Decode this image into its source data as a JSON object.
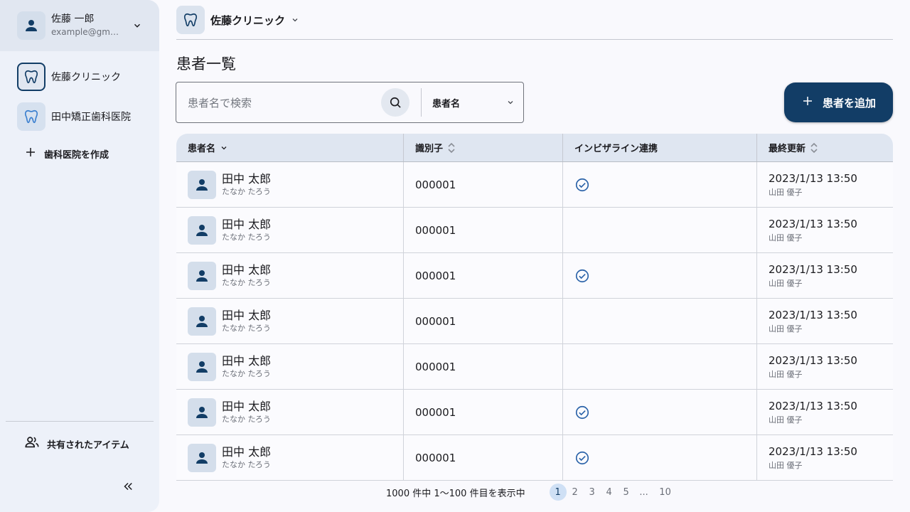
{
  "account": {
    "name": "佐藤 一郎",
    "email": "example@gma..."
  },
  "sidebar": {
    "clinics": [
      {
        "label": "佐藤クリニック",
        "active": true
      },
      {
        "label": "田中矯正歯科医院",
        "active": false
      }
    ],
    "create_label": "歯科医院を作成",
    "shared_label": "共有されたアイテム"
  },
  "header": {
    "clinic_name": "佐藤クリニック"
  },
  "page": {
    "title": "患者一覧"
  },
  "search": {
    "placeholder": "患者名で検索",
    "field_label": "患者名"
  },
  "add_button_label": "患者を追加",
  "table": {
    "columns": [
      "患者名",
      "識別子",
      "インビザライン連携",
      "最終更新"
    ],
    "rows": [
      {
        "name": "田中 太郎",
        "kana": "たなか たろう",
        "id": "000001",
        "linked": true,
        "updated": "2023/1/13 13:50",
        "updated_by": "山田 優子"
      },
      {
        "name": "田中 太郎",
        "kana": "たなか たろう",
        "id": "000001",
        "linked": false,
        "updated": "2023/1/13 13:50",
        "updated_by": "山田 優子"
      },
      {
        "name": "田中 太郎",
        "kana": "たなか たろう",
        "id": "000001",
        "linked": true,
        "updated": "2023/1/13 13:50",
        "updated_by": "山田 優子"
      },
      {
        "name": "田中 太郎",
        "kana": "たなか たろう",
        "id": "000001",
        "linked": false,
        "updated": "2023/1/13 13:50",
        "updated_by": "山田 優子"
      },
      {
        "name": "田中 太郎",
        "kana": "たなか たろう",
        "id": "000001",
        "linked": false,
        "updated": "2023/1/13 13:50",
        "updated_by": "山田 優子"
      },
      {
        "name": "田中 太郎",
        "kana": "たなか たろう",
        "id": "000001",
        "linked": true,
        "updated": "2023/1/13 13:50",
        "updated_by": "山田 優子"
      },
      {
        "name": "田中 太郎",
        "kana": "たなか たろう",
        "id": "000001",
        "linked": true,
        "updated": "2023/1/13 13:50",
        "updated_by": "山田 優子"
      }
    ]
  },
  "pagination": {
    "summary": "1000 件中  1～100 件目を表示中",
    "pages": [
      "1",
      "2",
      "3",
      "4",
      "5",
      "...",
      "10"
    ],
    "current": "1"
  },
  "colors": {
    "primary": "#123d66",
    "sidebar_bg": "#edf1f9",
    "header_bg": "#dfe6f1"
  },
  "icons": [
    "person-icon",
    "chevron-down-icon",
    "tooth-icon",
    "plus-icon",
    "people-icon",
    "double-chevron-left-icon",
    "search-icon",
    "sort-icon",
    "check-circle-icon"
  ]
}
